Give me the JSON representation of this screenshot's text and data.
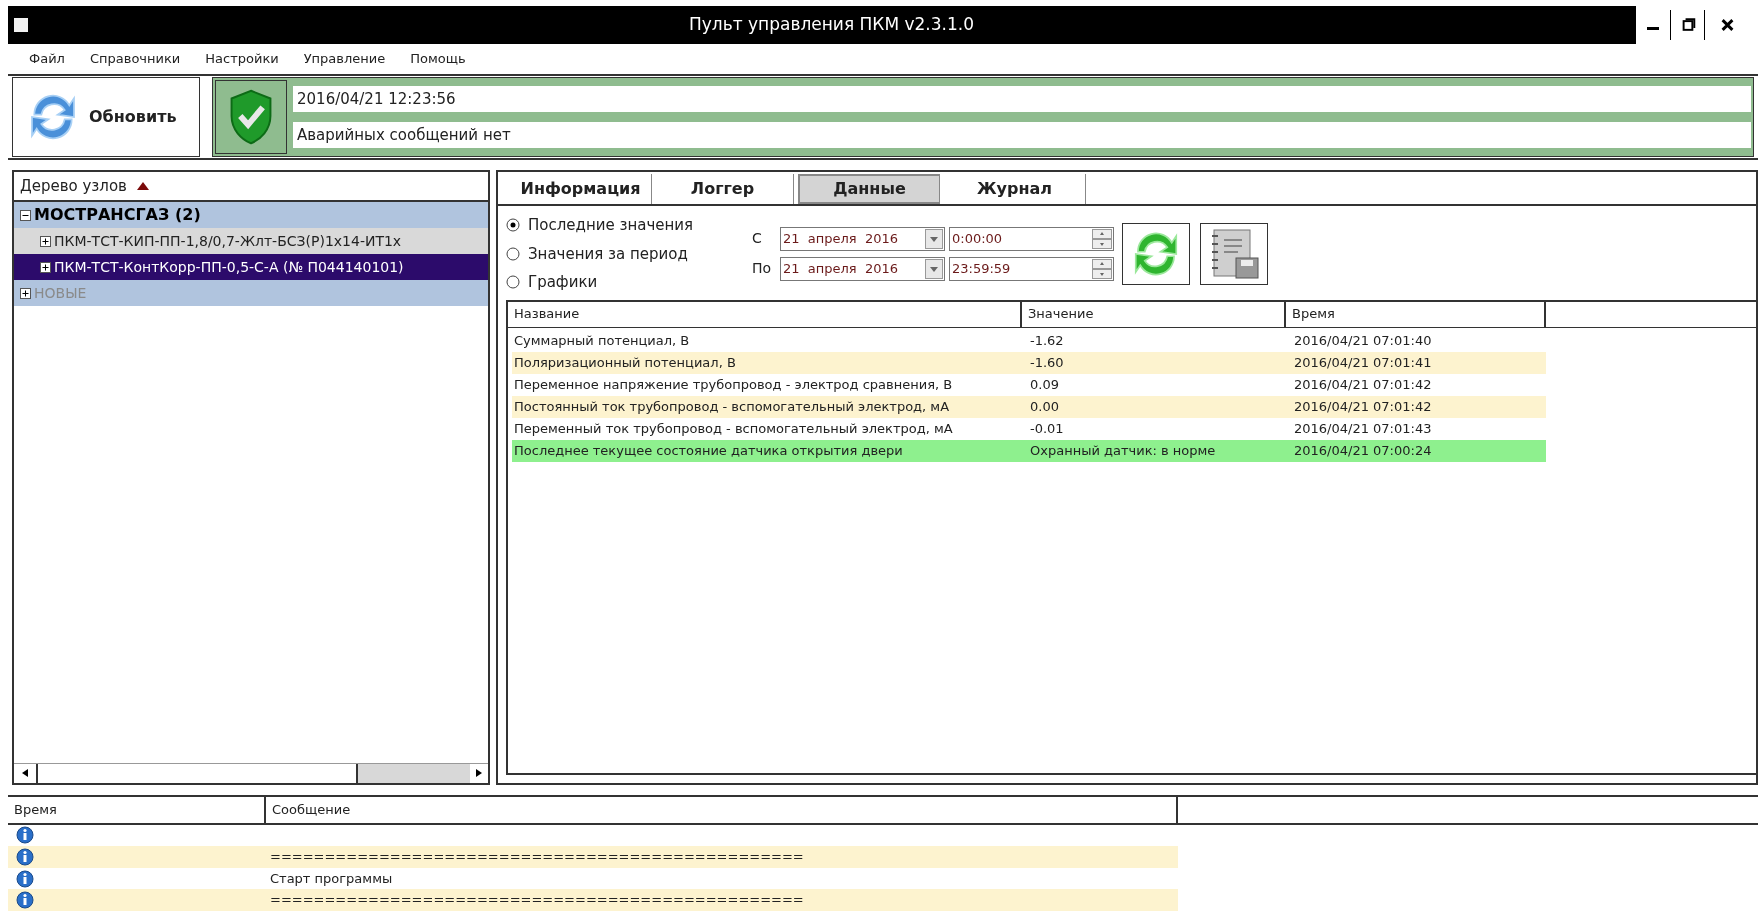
{
  "window": {
    "title": "Пульт управления ПКМ v2.3.1.0"
  },
  "menu": [
    "Файл",
    "Справочники",
    "Настройки",
    "Управление",
    "Помощь"
  ],
  "toolbar": {
    "refresh_label": "Обновить",
    "timestamp": "2016/04/21 12:23:56",
    "alarm_message": "Аварийных сообщений нет"
  },
  "tree": {
    "header": "Дерево узлов",
    "items": [
      {
        "label": "МОСТРАНСГАЗ (2)",
        "expanded": true,
        "selected": false,
        "disabled": false,
        "children": [
          {
            "label": "ПКМ-ТСТ-КИП-ПП-1,8/0,7-Жлт-БСЗ(Р)1x14-ИТ1x",
            "expanded": false,
            "selected": false,
            "disabled": false
          },
          {
            "label": "ПКМ-ТСТ-КонтКорр-ПП-0,5-С-А (№ П044140101)",
            "expanded": false,
            "selected": true,
            "disabled": false
          }
        ]
      },
      {
        "label": "НОВЫЕ",
        "expanded": false,
        "selected": false,
        "disabled": true
      }
    ]
  },
  "tabs": [
    {
      "label": "Информация",
      "selected": false
    },
    {
      "label": "Логгер",
      "selected": false
    },
    {
      "label": "Данные",
      "selected": true
    },
    {
      "label": "Журнал",
      "selected": false
    }
  ],
  "filters": {
    "modes": [
      {
        "label": "Последние значения",
        "selected": true
      },
      {
        "label": "Значения за период",
        "selected": false
      },
      {
        "label": "Графики",
        "selected": false
      }
    ],
    "from_label": "С",
    "from_date": "21  апреля  2016",
    "from_time": "0:00:00",
    "to_label": "По",
    "to_date": "21  апреля  2016",
    "to_time": "23:59:59"
  },
  "table": {
    "columns": [
      "Название",
      "Значение",
      "Время"
    ],
    "rows": [
      {
        "name": "Суммарный потенциал, В",
        "value": "-1.62",
        "time": "2016/04/21 07:01:40",
        "highlighted": false
      },
      {
        "name": "Поляризационный потенциал, В",
        "value": "-1.60",
        "time": "2016/04/21 07:01:41",
        "highlighted": false
      },
      {
        "name": "Переменное напряжение трубопровод - электрод сравнения, В",
        "value": "0.09",
        "time": "2016/04/21 07:01:42",
        "highlighted": false
      },
      {
        "name": "Постоянный ток трубопровод - вспомогательный электрод, мА",
        "value": "0.00",
        "time": "2016/04/21 07:01:42",
        "highlighted": false
      },
      {
        "name": "Переменный ток трубопровод - вспомогательный электрод, мА",
        "value": "-0.01",
        "time": "2016/04/21 07:01:43",
        "highlighted": false
      },
      {
        "name": "Последнее текущее состояние датчика открытия двери",
        "value": "Охранный датчик: в норме",
        "time": "2016/04/21 07:00:24",
        "highlighted": true
      }
    ]
  },
  "log": {
    "columns": [
      "Время",
      "Сообщение"
    ],
    "rows": [
      {
        "kind": "info"
      },
      {
        "kind": "info",
        "message": "================================================="
      },
      {
        "kind": "info",
        "message": "Старт программы"
      },
      {
        "kind": "info",
        "message": "================================================="
      }
    ]
  }
}
